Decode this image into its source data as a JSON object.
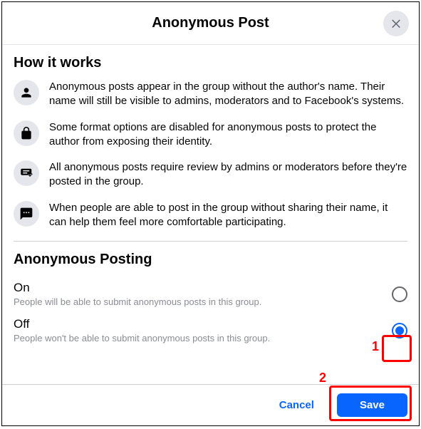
{
  "header": {
    "title": "Anonymous Post"
  },
  "howItWorks": {
    "title": "How it works",
    "items": [
      "Anonymous posts appear in the group without the author's name. Their name will still be visible to admins, moderators and to Facebook's systems.",
      "Some format options are disabled for anonymous posts to protect the author from exposing their identity.",
      "All anonymous posts require review by admins or moderators before they're posted in the group.",
      "When people are able to post in the group without sharing their name, it can help them feel more comfortable participating."
    ]
  },
  "anonymousPosting": {
    "title": "Anonymous Posting",
    "onLabel": "On",
    "onDesc": "People will be able to submit anonymous posts in this group.",
    "offLabel": "Off",
    "offDesc": "People won't be able to submit anonymous posts in this group."
  },
  "footer": {
    "cancel": "Cancel",
    "save": "Save"
  },
  "annotations": {
    "label1": "1",
    "label2": "2"
  }
}
